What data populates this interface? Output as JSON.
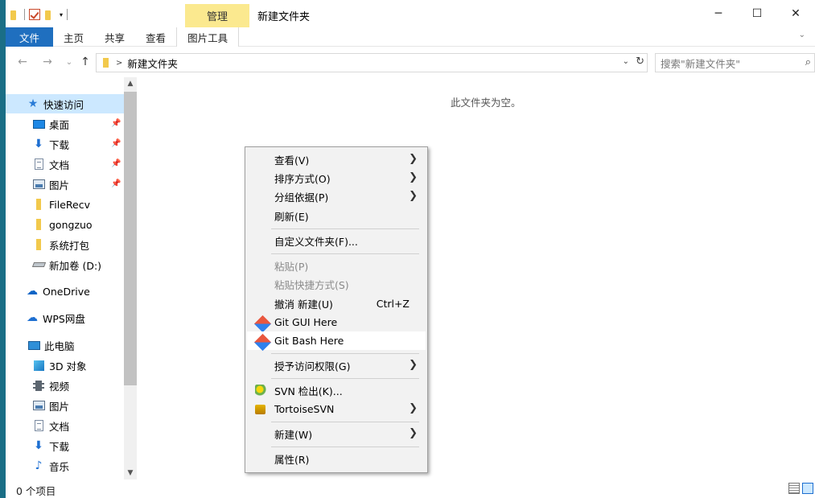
{
  "titlebar": {
    "context_tab": "管理",
    "title": "新建文件夹",
    "minimize": "─",
    "maximize": "☐",
    "close": "✕"
  },
  "ribbon": {
    "tabs": [
      "文件",
      "主页",
      "共享",
      "查看",
      "图片工具"
    ]
  },
  "address": {
    "back": "←",
    "forward": "→",
    "recent": "⌄",
    "up": "↑",
    "crumb": "新建文件夹",
    "dropdown": "⌄",
    "refresh": "↻",
    "search_placeholder": "搜索\"新建文件夹\"",
    "search_icon": "⌕"
  },
  "nav": {
    "quick_access": "快速访问",
    "items": [
      {
        "label": "桌面",
        "icon": "desktop-icon",
        "pinned": true
      },
      {
        "label": "下载",
        "icon": "download-icon",
        "pinned": true
      },
      {
        "label": "文档",
        "icon": "document-icon",
        "pinned": true
      },
      {
        "label": "图片",
        "icon": "pictures-icon",
        "pinned": true
      },
      {
        "label": "FileRecv",
        "icon": "folder-icon",
        "pinned": false
      },
      {
        "label": "gongzuo",
        "icon": "folder-icon",
        "pinned": false
      },
      {
        "label": "系统打包",
        "icon": "folder-icon",
        "pinned": false
      },
      {
        "label": "新加卷 (D:)",
        "icon": "drive-icon",
        "pinned": false
      }
    ],
    "onedrive": "OneDrive",
    "wps": "WPS网盘",
    "this_pc": "此电脑",
    "pc_items": [
      {
        "label": "3D 对象",
        "icon": "3d-objects-icon"
      },
      {
        "label": "视频",
        "icon": "video-icon"
      },
      {
        "label": "图片",
        "icon": "pictures-icon"
      },
      {
        "label": "文档",
        "icon": "document-icon"
      },
      {
        "label": "下载",
        "icon": "download-icon"
      },
      {
        "label": "音乐",
        "icon": "music-icon"
      }
    ]
  },
  "content": {
    "empty_message": "此文件夹为空。"
  },
  "status": {
    "item_count": "0 个项目"
  },
  "context_menu": {
    "view": "查看(V)",
    "sort": "排序方式(O)",
    "group": "分组依据(P)",
    "refresh": "刷新(E)",
    "customize": "自定义文件夹(F)...",
    "paste": "粘贴(P)",
    "paste_shortcut": "粘贴快捷方式(S)",
    "undo": "撤消 新建(U)",
    "undo_shortcut": "Ctrl+Z",
    "git_gui": "Git GUI Here",
    "git_bash": "Git Bash Here",
    "grant_access": "授予访问权限(G)",
    "svn_checkout": "SVN 检出(K)...",
    "tortoise": "TortoiseSVN",
    "new": "新建(W)",
    "properties": "属性(R)",
    "arrow": "❯"
  }
}
